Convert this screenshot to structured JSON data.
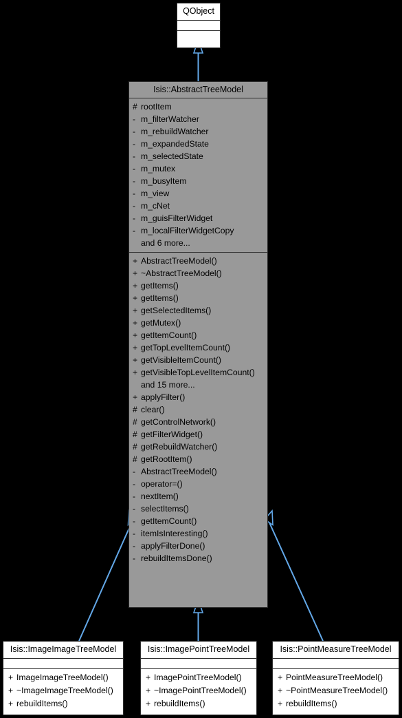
{
  "diagram": {
    "kind": "uml-class-inheritance-diagram",
    "background_color": "#000000",
    "edge_color": "#63a8e8",
    "base_class_fill": "#999999",
    "derived_class_fill": "#ffffff",
    "border_color": "#2b2b2b",
    "text_color": "#000000"
  },
  "classes": {
    "qobject": {
      "name": "QObject",
      "attributes": [],
      "methods": []
    },
    "abstract_tree_model": {
      "name": "Isis::AbstractTreeModel",
      "attributes": [
        {
          "visibility": "#",
          "label": "rootItem"
        },
        {
          "visibility": "-",
          "label": "m_filterWatcher"
        },
        {
          "visibility": "-",
          "label": "m_rebuildWatcher"
        },
        {
          "visibility": "-",
          "label": "m_expandedState"
        },
        {
          "visibility": "-",
          "label": "m_selectedState"
        },
        {
          "visibility": "-",
          "label": "m_mutex"
        },
        {
          "visibility": "-",
          "label": "m_busyItem"
        },
        {
          "visibility": "-",
          "label": "m_view"
        },
        {
          "visibility": "-",
          "label": "m_cNet"
        },
        {
          "visibility": "-",
          "label": "m_guisFilterWidget"
        },
        {
          "visibility": "-",
          "label": "m_localFilterWidgetCopy"
        },
        {
          "visibility": "",
          "label": "and 6 more..."
        }
      ],
      "methods": [
        {
          "visibility": "+",
          "label": "AbstractTreeModel()"
        },
        {
          "visibility": "+",
          "label": "~AbstractTreeModel()"
        },
        {
          "visibility": "+",
          "label": "getItems()"
        },
        {
          "visibility": "+",
          "label": "getItems()"
        },
        {
          "visibility": "+",
          "label": "getSelectedItems()"
        },
        {
          "visibility": "+",
          "label": "getMutex()"
        },
        {
          "visibility": "+",
          "label": "getItemCount()"
        },
        {
          "visibility": "+",
          "label": "getTopLevelItemCount()"
        },
        {
          "visibility": "+",
          "label": "getVisibleItemCount()"
        },
        {
          "visibility": "+",
          "label": "getVisibleTopLevelItemCount()"
        },
        {
          "visibility": "",
          "label": "and 15 more..."
        },
        {
          "visibility": "+",
          "label": "applyFilter()"
        },
        {
          "visibility": "#",
          "label": "clear()"
        },
        {
          "visibility": "#",
          "label": "getControlNetwork()"
        },
        {
          "visibility": "#",
          "label": "getFilterWidget()"
        },
        {
          "visibility": "#",
          "label": "getRebuildWatcher()"
        },
        {
          "visibility": "#",
          "label": "getRootItem()"
        },
        {
          "visibility": "-",
          "label": "AbstractTreeModel()"
        },
        {
          "visibility": "-",
          "label": "operator=()"
        },
        {
          "visibility": "-",
          "label": "nextItem()"
        },
        {
          "visibility": "-",
          "label": "selectItems()"
        },
        {
          "visibility": "-",
          "label": "getItemCount()"
        },
        {
          "visibility": "-",
          "label": "itemIsInteresting()"
        },
        {
          "visibility": "-",
          "label": "applyFilterDone()"
        },
        {
          "visibility": "-",
          "label": "rebuildItemsDone()"
        }
      ]
    },
    "image_image_tree_model": {
      "name": "Isis::ImageImageTreeModel",
      "attributes": [],
      "methods": [
        {
          "visibility": "+",
          "label": "ImageImageTreeModel()"
        },
        {
          "visibility": "+",
          "label": "~ImageImageTreeModel()"
        },
        {
          "visibility": "+",
          "label": "rebuildItems()"
        }
      ]
    },
    "image_point_tree_model": {
      "name": "Isis::ImagePointTreeModel",
      "attributes": [],
      "methods": [
        {
          "visibility": "+",
          "label": "ImagePointTreeModel()"
        },
        {
          "visibility": "+",
          "label": "~ImagePointTreeModel()"
        },
        {
          "visibility": "+",
          "label": "rebuildItems()"
        }
      ]
    },
    "point_measure_tree_model": {
      "name": "Isis::PointMeasureTreeModel",
      "attributes": [],
      "methods": [
        {
          "visibility": "+",
          "label": "PointMeasureTreeModel()"
        },
        {
          "visibility": "+",
          "label": "~PointMeasureTreeModel()"
        },
        {
          "visibility": "+",
          "label": "rebuildItems()"
        }
      ]
    }
  },
  "edges": [
    {
      "from": "abstract_tree_model",
      "to": "qobject",
      "type": "inheritance"
    },
    {
      "from": "image_image_tree_model",
      "to": "abstract_tree_model",
      "type": "inheritance"
    },
    {
      "from": "image_point_tree_model",
      "to": "abstract_tree_model",
      "type": "inheritance"
    },
    {
      "from": "point_measure_tree_model",
      "to": "abstract_tree_model",
      "type": "inheritance"
    }
  ]
}
